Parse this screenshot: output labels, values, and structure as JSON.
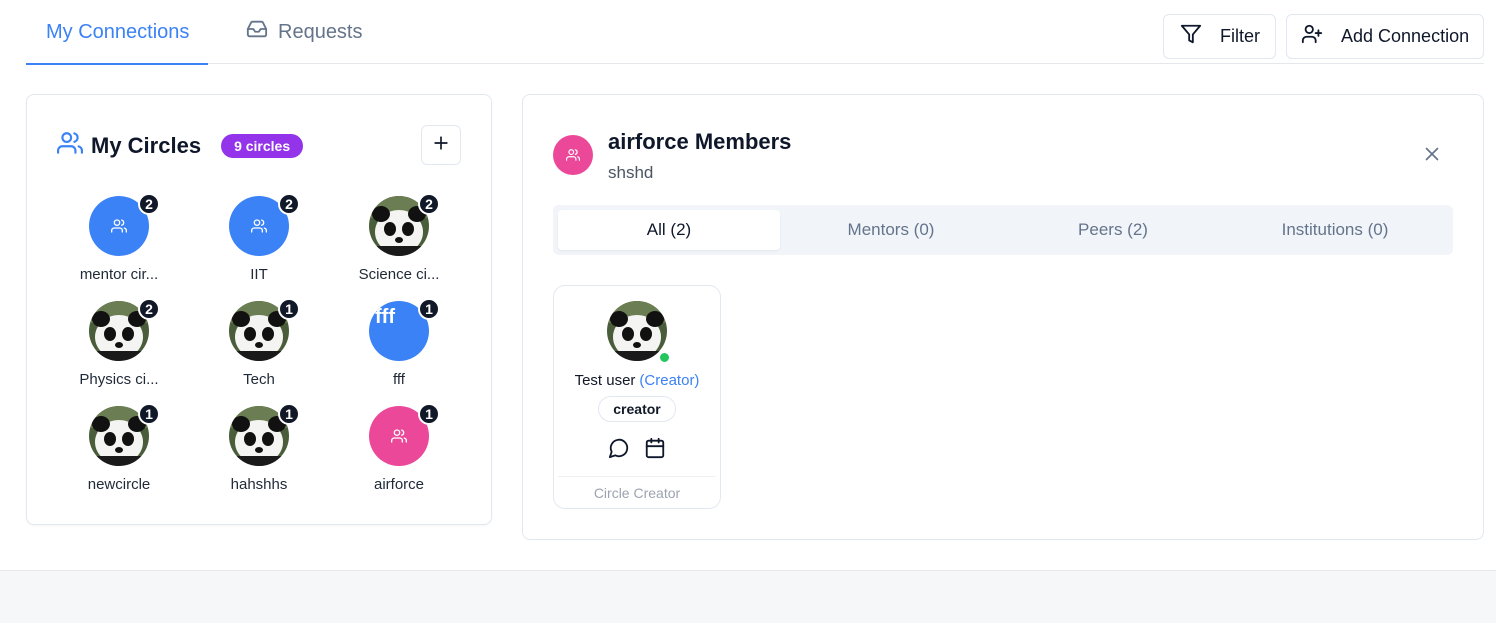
{
  "tabs": {
    "connections": "My Connections",
    "requests": "Requests"
  },
  "actions": {
    "filter": "Filter",
    "add_connection": "Add Connection"
  },
  "circles": {
    "title": "My Circles",
    "badge": "9 circles",
    "items": [
      {
        "name": "mentor cir...",
        "count": "2",
        "avatar": "group-icon",
        "color": "#3b82f6"
      },
      {
        "name": "IIT",
        "count": "2",
        "avatar": "group-icon",
        "color": "#3b82f6"
      },
      {
        "name": "Science ci...",
        "count": "2",
        "avatar": "panda-photo"
      },
      {
        "name": "Physics ci...",
        "count": "2",
        "avatar": "panda-photo"
      },
      {
        "name": "Tech",
        "count": "1",
        "avatar": "panda-photo"
      },
      {
        "name": "fff",
        "count": "1",
        "avatar": "broken-image",
        "alt": "fff",
        "color": "#3b82f6"
      },
      {
        "name": "newcircle",
        "count": "1",
        "avatar": "panda-photo"
      },
      {
        "name": "hahshhs",
        "count": "1",
        "avatar": "panda-photo"
      },
      {
        "name": "airforce",
        "count": "1",
        "avatar": "group-icon",
        "color": "#ec4899"
      }
    ]
  },
  "members": {
    "title": "airforce Members",
    "subtitle": "shshd",
    "filters": [
      "All (2)",
      "Mentors (0)",
      "Peers (2)",
      "Institutions (0)"
    ],
    "active_filter": "All (2)",
    "cards": [
      {
        "name": "Test user",
        "role_tag": "(Creator)",
        "role_badge": "creator",
        "footer": "Circle Creator",
        "online": true
      }
    ]
  },
  "colors": {
    "accent": "#3b82f6",
    "badge_purple": "#9333ea",
    "pink": "#ec4899",
    "online_green": "#22c55e"
  }
}
